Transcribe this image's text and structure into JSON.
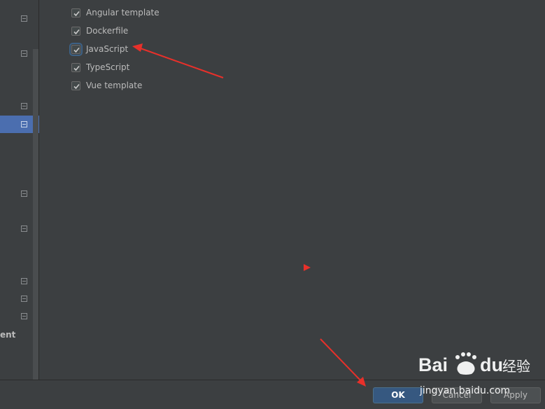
{
  "left_panel": {
    "partial_text": "ent",
    "row_icon": "collapse-icon"
  },
  "templates": [
    {
      "label": "Angular template",
      "checked": true
    },
    {
      "label": "Dockerfile",
      "checked": true
    },
    {
      "label": "JavaScript",
      "checked": true,
      "focused": true
    },
    {
      "label": "TypeScript",
      "checked": true
    },
    {
      "label": "Vue template",
      "checked": true
    }
  ],
  "buttons": {
    "ok": "OK",
    "cancel": "Cancel",
    "apply": "Apply"
  },
  "annotation": {
    "arrow_color": "#e8302a"
  },
  "watermark": {
    "brand": "Bai du 经验",
    "site": "jingyan.baidu.com"
  }
}
